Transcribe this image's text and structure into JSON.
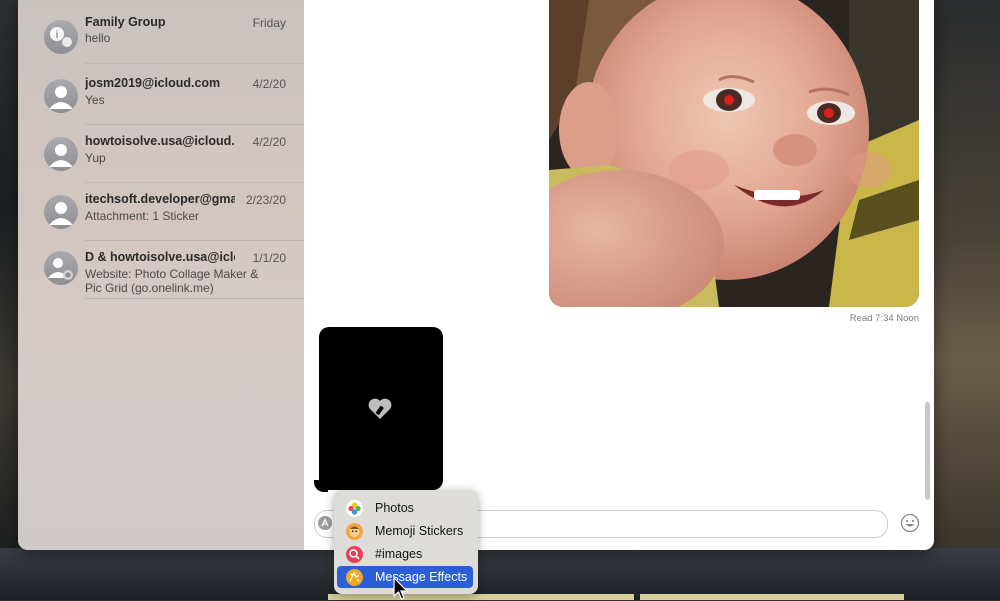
{
  "conversations": [
    {
      "name": "Family Group",
      "date": "Friday",
      "preview": "hello",
      "avatar": "group-icon"
    },
    {
      "name": "josm2019@icloud.com",
      "date": "4/2/20",
      "preview": "Yes",
      "avatar": "person-icon"
    },
    {
      "name": "howtoisolve.usa@icloud.com",
      "date": "4/2/20",
      "preview": "Yup",
      "avatar": "person-icon"
    },
    {
      "name": "itechsoft.developer@gma...",
      "date": "2/23/20",
      "preview": "Attachment: 1 Sticker",
      "avatar": "person-icon"
    },
    {
      "name": "D & howtoisolve.usa@iclou...",
      "date": "1/1/20",
      "preview": "Website: Photo Collage Maker & Pic Grid (go.onelink.me)",
      "avatar": "group-icon"
    }
  ],
  "chat": {
    "read_receipt": "Read 7:34 Noon"
  },
  "apps_menu": {
    "items": [
      {
        "label": "Photos",
        "icon": "photos-icon",
        "color": "#ffffff"
      },
      {
        "label": "Memoji Stickers",
        "icon": "memoji-icon",
        "color": "#f2a541"
      },
      {
        "label": "#images",
        "icon": "images-search-icon",
        "color": "#e8405a"
      },
      {
        "label": "Message Effects",
        "icon": "message-effects-icon",
        "color": "#f5a623",
        "selected": true
      }
    ]
  },
  "colors": {
    "selection": "#2b5fd9",
    "sidebar": "#d3c6c1"
  }
}
